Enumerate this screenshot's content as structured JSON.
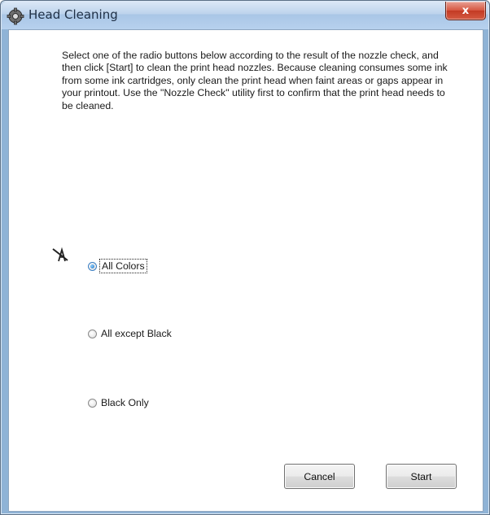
{
  "window": {
    "title": "Head Cleaning",
    "close_label": "x"
  },
  "instructions": "Select one of the radio buttons below according to the result of the nozzle check, and then click [Start] to clean the print head nozzles. Because cleaning consumes some ink from some ink cartridges, only clean the print head when faint areas or gaps appear in your printout. Use the \"Nozzle Check\" utility first to confirm that the print head needs to be cleaned.",
  "options": [
    {
      "label": "All Colors",
      "checked": true
    },
    {
      "label": "All except Black",
      "checked": false
    },
    {
      "label": "Black Only",
      "checked": false
    }
  ],
  "buttons": {
    "cancel": "Cancel",
    "start": "Start"
  },
  "icons": {
    "app": "printer-settings-icon",
    "warning": "pen-warning-icon"
  }
}
